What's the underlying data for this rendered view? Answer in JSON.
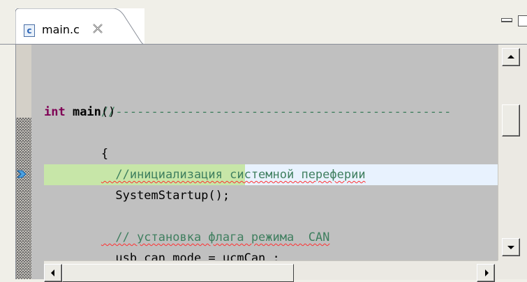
{
  "editor": {
    "tab": {
      "file_name": "main.c",
      "icon_letter": "c",
      "icon": "c-source-file-icon",
      "close_glyph": "✕"
    },
    "view_controls": {
      "minimize_icon": "minimize-icon",
      "maximize_icon": "maximize-icon"
    },
    "code_lines": [
      {
        "text": "//-----------------------------------------------",
        "kind": "comment"
      },
      {
        "kw": "int",
        "name": " main",
        "rest": "()"
      },
      {
        "text": "{"
      },
      {
        "text": "  //инициализация системной переферии",
        "kind": "comment-squiggle"
      },
      {
        "text": "  SystemStartup();",
        "current": true
      },
      {
        "text": ""
      },
      {
        "text": "  // установка флага режима  CAN",
        "kind": "comment-squiggle"
      },
      {
        "text": "  usb_can_mode = ucmCan ;",
        "kind": "squiggle-partial"
      }
    ]
  },
  "colors": {
    "comment": "#3f7f5f",
    "keyword": "#7f0055",
    "current_line": "#c7e6a8",
    "line_highlight": "#e8f2fe",
    "editor_bg": "#c0c0c0"
  }
}
